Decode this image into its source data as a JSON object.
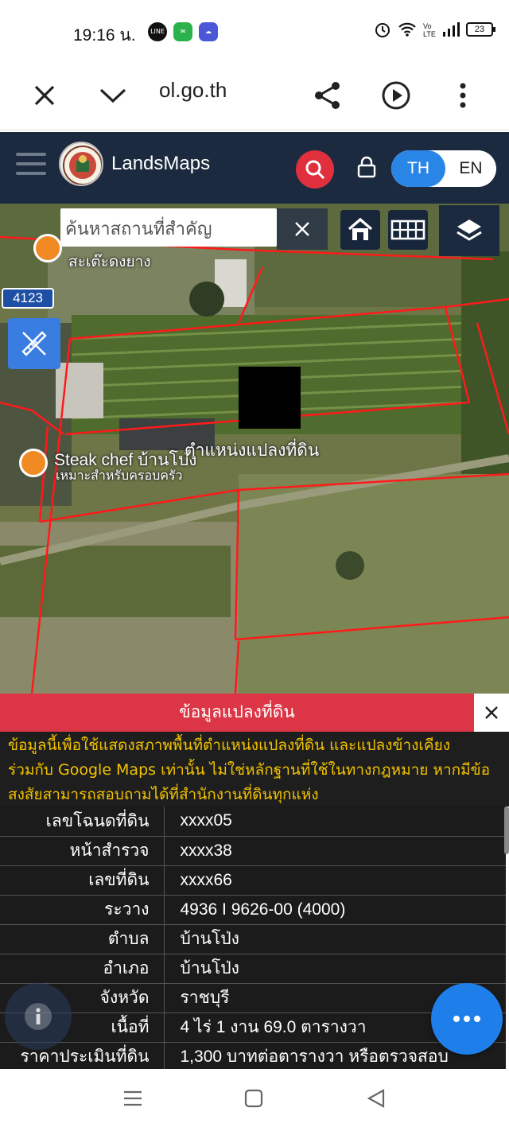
{
  "status_bar": {
    "time": "19:16 น.",
    "battery": "23"
  },
  "browser": {
    "url": "ol.go.th"
  },
  "app": {
    "name": "LandsMaps",
    "lang_th": "TH",
    "lang_en": "EN",
    "accent_color": "#1c2a3f",
    "search_color": "#e0303e"
  },
  "map": {
    "search_placeholder": "ค้นหาสถานที่สำคัญ",
    "road_number": "4123",
    "poi_1": "สะเต๊ะดงยาง",
    "poi_2": "Steak chef บ้านโป่ง",
    "poi_2_sub": "เหมาะสำหรับครอบครัว",
    "parcel_label": "ตำแหน่งแปลงที่ดิน"
  },
  "panel": {
    "title": "ข้อมูลแปลงที่ดิน",
    "notice_lines": [
      "ข้อมูลนี้เพื่อใช้แสดงสภาพพื้นที่ตำแหน่งแปลงที่ดิน และแปลงข้างเคียง",
      "ร่วมกับ Google Maps เท่านั้น ไม่ใช่หลักฐานที่ใช้ในทางกฎหมาย หากมีข้อ",
      "สงสัยสามารถสอบถามได้ที่สำนักงานที่ดินทุกแห่ง"
    ],
    "rows": [
      {
        "label": "เลขโฉนดที่ดิน",
        "value": "xxxx05"
      },
      {
        "label": "หน้าสำรวจ",
        "value": "xxxx38"
      },
      {
        "label": "เลขที่ดิน",
        "value": "xxxx66"
      },
      {
        "label": "ระวาง",
        "value": "4936 I 9626-00 (4000)"
      },
      {
        "label": "ตำบล",
        "value": "บ้านโป่ง"
      },
      {
        "label": "อำเภอ",
        "value": "บ้านโป่ง"
      },
      {
        "label": "จังหวัด",
        "value": "ราชบุรี"
      },
      {
        "label": "เนื้อที่",
        "value": "4 ไร่ 1 งาน 69.0 ตารางวา"
      },
      {
        "label": "ราคาประเมินที่ดิน",
        "value": "1,300 บาทต่อตารางวา หรือตรวจสอบ"
      }
    ]
  }
}
